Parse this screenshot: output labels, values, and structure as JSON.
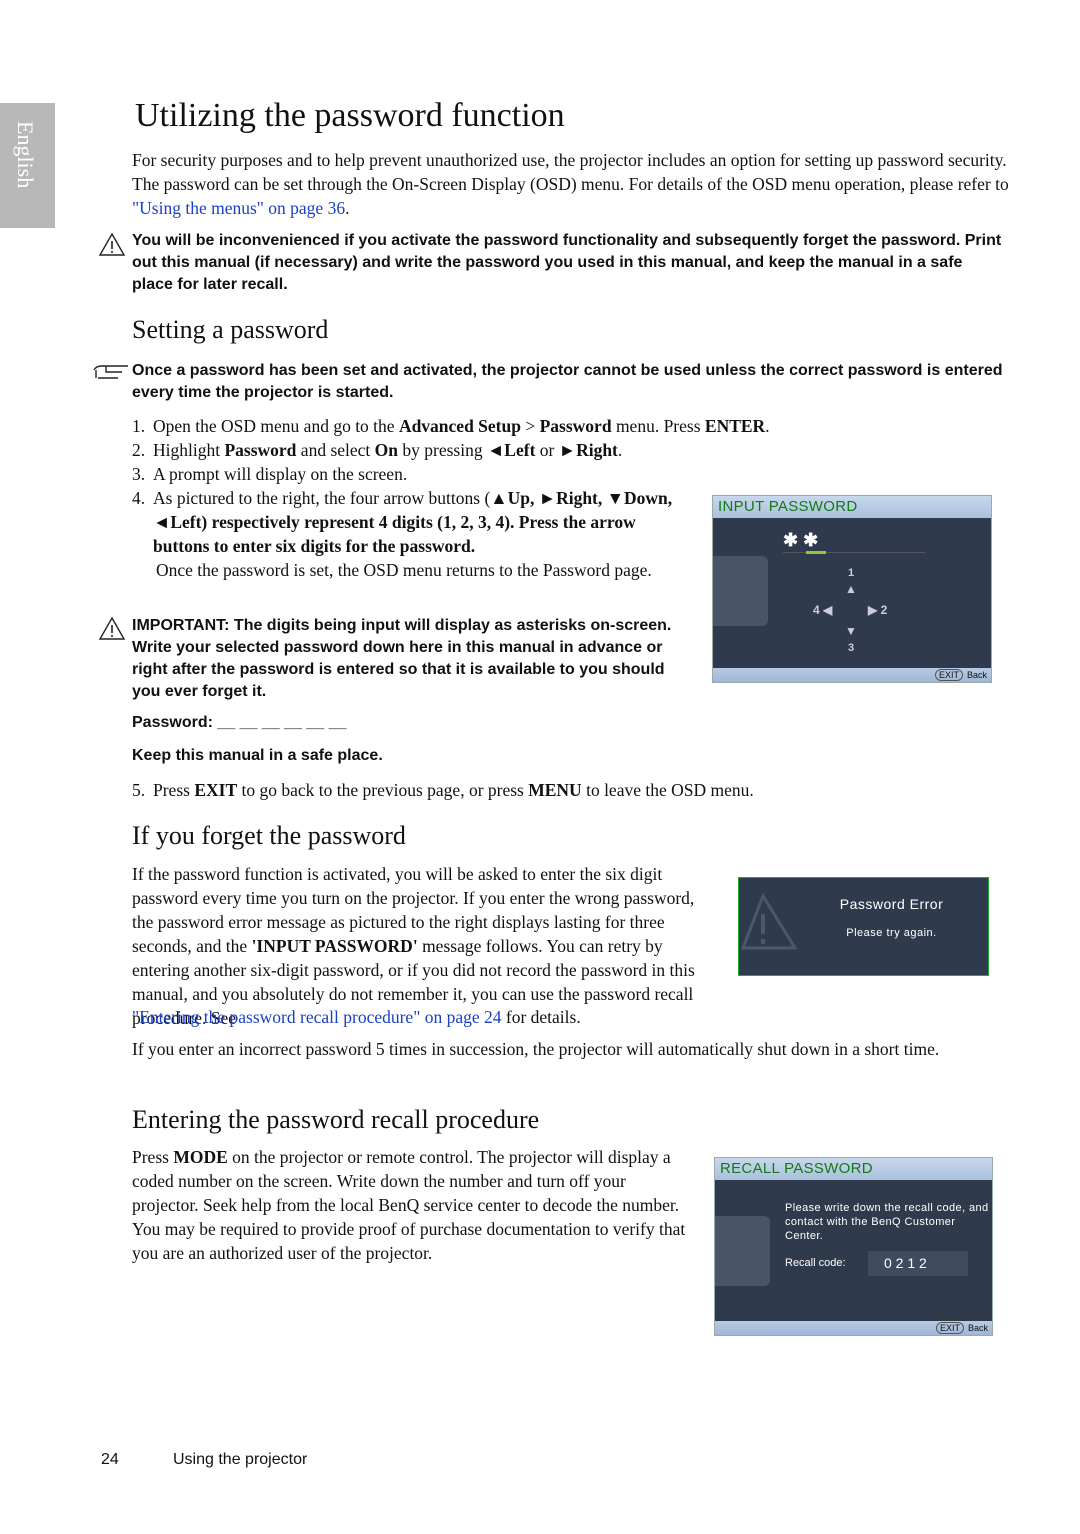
{
  "side_tab": "English",
  "title": "Utilizing the password function",
  "intro": [
    "For security purposes and to help prevent unauthorized use, the projector includes an option for setting up password security. The password can be set through the On-Screen Display (OSD) menu. For details of the OSD menu operation, please refer to ",
    "\"Using the menus\" on page 36",
    "."
  ],
  "warning1": "You will be inconvenienced if you activate the password functionality and subsequently forget the password. Print out this manual (if necessary) and write the password you used in this manual, and keep the manual in a safe place for later recall.",
  "setting": {
    "heading": "Setting a password",
    "note": "Once a password has been set and activated, the projector cannot be used unless the correct password is entered every time the projector is started.",
    "steps": [
      "1.",
      "2.",
      "3.",
      "4."
    ],
    "step1": [
      "Open the OSD menu and go to the ",
      "Advanced Setup",
      " > ",
      "Password",
      " menu. Press ",
      "ENTER",
      "."
    ],
    "step2": [
      "Highlight ",
      "Password",
      " and select ",
      "On",
      " by pressing ",
      "◄",
      "Left",
      " or ",
      "►",
      "Right",
      "."
    ],
    "step3": "A prompt will display on the screen.",
    "step4": [
      "As pictured to the right, the four arrow buttons (",
      "▲",
      "Up, ",
      "►",
      "Right, ",
      "▼",
      "Down, ",
      "◄",
      "Left) respectively represent 4 digits (1, 2, 3, 4). Press the arrow buttons to enter six digits for the password."
    ],
    "step4b": "Once the password is set, the OSD menu returns to the Password page.",
    "important": "IMPORTANT: The digits being input will display as asterisks on-screen. Write your selected password down here in this manual in advance or right after the password is entered so that it is available to you should you ever forget it.",
    "password_label": "Password: __ __ __ __ __ __",
    "keep": "Keep this manual in a safe place.",
    "step5": [
      "5.",
      "Press ",
      "EXIT",
      " to go back to the previous page, or press ",
      "MENU",
      " to leave the OSD menu."
    ]
  },
  "osd_input": {
    "title": "INPUT PASSWORD",
    "entered": "✱ ✱",
    "digits": [
      "1",
      "2",
      "3",
      "4"
    ],
    "exit": "EXIT",
    "back": "Back",
    "accent": "#8cc63f"
  },
  "forget": {
    "heading": "If you forget the password",
    "p1": [
      "If the password function is activated, you will be asked to enter the six digit password every time you turn on the projector. If you enter the wrong password, the password error message as pictured to the right displays lasting for three seconds, and the ",
      "'INPUT PASSWORD'",
      " message follows. You can retry by entering another six-digit password, or if you did not record the password in this manual, and you absolutely do not remember it, you can use the password recall procedure. See ",
      "\"Entering the password recall procedure\" on page 24",
      " for details."
    ],
    "p2": "If you enter an incorrect password 5 times in succession, the projector will automatically shut down in a short time."
  },
  "osd_error": {
    "title": "Password Error",
    "sub": "Please try again."
  },
  "recall": {
    "heading": "Entering the password recall procedure",
    "p": [
      "Press ",
      "MODE",
      " on the projector or remote control. The projector will display a coded number on the screen. Write down the number and turn off your projector. Seek help from the local BenQ service center to decode the number. You may be required to provide proof of purchase documentation to verify that you are an authorized user of the projector."
    ]
  },
  "osd_recall": {
    "title": "RECALL PASSWORD",
    "msg": "Please write down the recall code, and contact with the BenQ Customer Center.",
    "code_label": "Recall code:",
    "code": "0 2 1 2",
    "exit": "EXIT",
    "back": "Back"
  },
  "footer": {
    "page": "24",
    "section": "Using the projector"
  }
}
